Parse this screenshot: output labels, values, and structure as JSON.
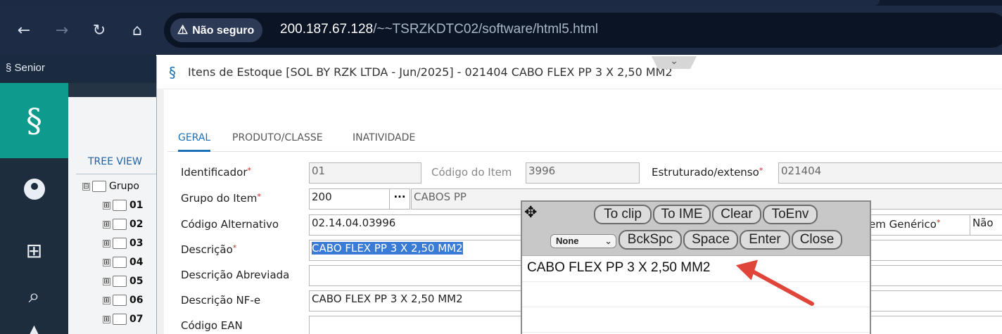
{
  "browser": {
    "security_label": "Não seguro",
    "url_host": "200.187.67.128",
    "url_path": "/~~TSRZKDTC02/software/html5.html",
    "icons": [
      "back-icon",
      "forward-icon",
      "reload-icon",
      "home-icon",
      "warning-icon"
    ]
  },
  "app": {
    "brand": "Senior",
    "tree_view_label": "TREE VIEW",
    "tree_items": [
      {
        "toggle": "⊟",
        "label": "Grupo"
      },
      {
        "toggle": "⊞",
        "label": "01"
      },
      {
        "toggle": "⊞",
        "label": "02"
      },
      {
        "toggle": "⊞",
        "label": "03"
      },
      {
        "toggle": "⊞",
        "label": "04"
      },
      {
        "toggle": "⊞",
        "label": "05"
      },
      {
        "toggle": "⊞",
        "label": "06"
      },
      {
        "toggle": "⊞",
        "label": "07"
      }
    ]
  },
  "window": {
    "title": "Itens de Estoque [SOL BY RZK LTDA - Jun/2025]  - 021404 CABO FLEX PP 3 X 2,50 MM2",
    "tabs": [
      "GERAL",
      "PRODUTO/CLASSE",
      "INATIVIDADE"
    ],
    "active_tab": "GERAL"
  },
  "form": {
    "identificador_label": "Identificador",
    "identificador_value": "01",
    "codigo_item_label": "Código do Item",
    "codigo_item_value": "3996",
    "estruturado_label": "Estruturado/extenso",
    "estruturado_value": "021404",
    "grupo_label": "Grupo do Item",
    "grupo_value": "200",
    "grupo_lookup_label": "···",
    "grupo_desc": "CABOS PP",
    "codigo_alt_label": "Código Alternativo",
    "codigo_alt_value": "02.14.04.03996",
    "generico_label": "em Genérico",
    "generico_value": "Não",
    "descricao_label": "Descrição",
    "descricao_value": "CABO FLEX PP 3 X 2,50 MM2",
    "descricao_abrev_label": "Descrição Abreviada",
    "descricao_abrev_value": "",
    "descricao_nfe_label": "Descrição NF-e",
    "descricao_nfe_value": "CABO FLEX PP 3 X 2,50 MM2",
    "codigo_ean_label": "Código EAN",
    "codigo_ean_value": "",
    "required_mark": "*"
  },
  "ime": {
    "buttons_row1": [
      "To clip",
      "To IME",
      "Clear",
      "ToEnv"
    ],
    "buttons_row2": [
      "BckSpc",
      "Space",
      "Enter",
      "Close"
    ],
    "select_value": "None",
    "text": "CABO FLEX PP 3 X 2,50 MM2"
  },
  "colors": {
    "accent": "#1a6fb8",
    "teal": "#0e9a8c",
    "arrow": "#e0453a",
    "required": "#e02020"
  }
}
